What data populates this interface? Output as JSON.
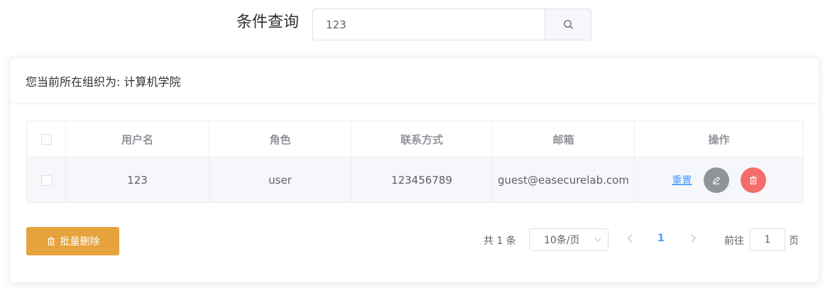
{
  "search": {
    "label": "条件查询",
    "value": "123",
    "button_icon": "search-icon"
  },
  "card": {
    "header": "您当前所在组织为: 计算机学院"
  },
  "table": {
    "columns": [
      "",
      "用户名",
      "角色",
      "联系方式",
      "邮箱",
      "操作"
    ],
    "rows": [
      {
        "username": "123",
        "role": "user",
        "contact": "123456789",
        "email": "guest@easecurelab.com",
        "actions": {
          "reset_label": "重置",
          "edit_icon": "edit-icon",
          "delete_icon": "delete-icon"
        }
      }
    ]
  },
  "batch_delete": {
    "label": "批量删除",
    "icon": "trash-icon"
  },
  "pagination": {
    "total": "共 1 条",
    "page_size": "10条/页",
    "current_page": "1",
    "goto_label": "前往",
    "goto_value": "1",
    "goto_suffix": "页"
  },
  "colors": {
    "primary": "#409eff",
    "warning": "#e6a23c",
    "danger": "#f56c6c",
    "info": "#909399"
  }
}
